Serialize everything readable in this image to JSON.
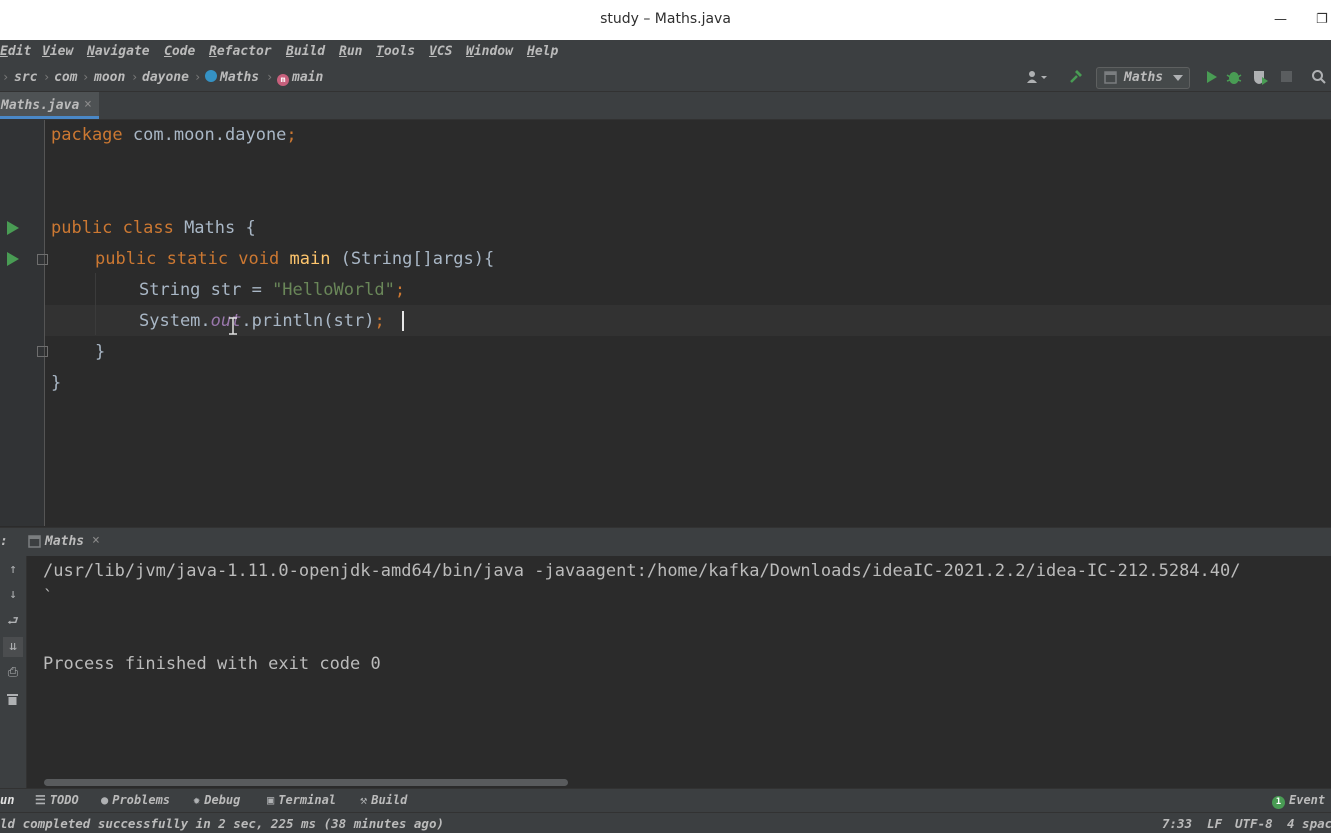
{
  "window": {
    "title": "study – Maths.java",
    "minimize_glyph": "—",
    "restore_glyph": "❐"
  },
  "menu": [
    {
      "label": "Edit",
      "mnemonic_index": 0
    },
    {
      "label": "View",
      "mnemonic_index": 0
    },
    {
      "label": "Navigate",
      "mnemonic_index": 0
    },
    {
      "label": "Code",
      "mnemonic_index": 0
    },
    {
      "label": "Refactor",
      "mnemonic_index": 0
    },
    {
      "label": "Build",
      "mnemonic_index": 0
    },
    {
      "label": "Run",
      "mnemonic_index": 0
    },
    {
      "label": "Tools",
      "mnemonic_index": 0
    },
    {
      "label": "VCS",
      "mnemonic_index": 0
    },
    {
      "label": "Window",
      "mnemonic_index": 0
    },
    {
      "label": "Help",
      "mnemonic_index": 0
    }
  ],
  "breadcrumbs": [
    "src",
    "com",
    "moon",
    "dayone",
    "Maths",
    "main"
  ],
  "run_config": {
    "label": "Maths"
  },
  "tabs": [
    {
      "label": "Maths.java",
      "active": true
    }
  ],
  "editor": {
    "lines": [
      "package com.moon.dayone;",
      "",
      "",
      "public class Maths {",
      "    public static void main (String[]args){",
      "        String str = \"HelloWorld\";",
      "        System.out.println(str);",
      "    }",
      "}"
    ],
    "code": {
      "l1_kw": "package",
      "l1_rest": " com.moon.dayone",
      "l1_semi": ";",
      "l4_kw": "public class",
      "l4_rest": " Maths {",
      "l5_kw": "public static void",
      "l5_fn": "main",
      "l5_rest": " (String[]args){",
      "l6_a": "String str = ",
      "l6_str": "\"HelloWorld\"",
      "l6_semi": ";",
      "l7_a": "System.",
      "l7_fld": "out",
      "l7_b": ".println(str)",
      "l7_semi": ";",
      "l8": "}",
      "l9": "}"
    },
    "cursor": "7:33"
  },
  "run_panel": {
    "prefix": ":",
    "tab_label": "Maths",
    "output": [
      "/usr/lib/jvm/java-1.11.0-openjdk-amd64/bin/java -javaagent:/home/kafka/Downloads/ideaIC-2021.2.2/idea-IC-212.5284.40/",
      "`",
      "",
      "Process finished with exit code 0"
    ]
  },
  "tool_windows": [
    {
      "label": "un",
      "icon": "run-icon"
    },
    {
      "label": "TODO",
      "icon": "list-icon"
    },
    {
      "label": "Problems",
      "icon": "problems-icon"
    },
    {
      "label": "Debug",
      "icon": "bug-icon"
    },
    {
      "label": "Terminal",
      "icon": "terminal-icon"
    },
    {
      "label": "Build",
      "icon": "hammer-icon"
    }
  ],
  "event_log": {
    "count": "1",
    "label": "Event"
  },
  "status": {
    "message": "ld completed successfully in 2 sec, 225 ms (38 minutes ago)",
    "position": "7:33",
    "line_sep": "LF",
    "encoding": "UTF-8",
    "indent": "4 spac"
  },
  "colors": {
    "keyword": "#cc7832",
    "string": "#6a8759",
    "method": "#ffc66d",
    "field": "#9876aa",
    "text": "#a9b7c6",
    "run_green": "#499c54",
    "accent_blue": "#4a88c7"
  }
}
